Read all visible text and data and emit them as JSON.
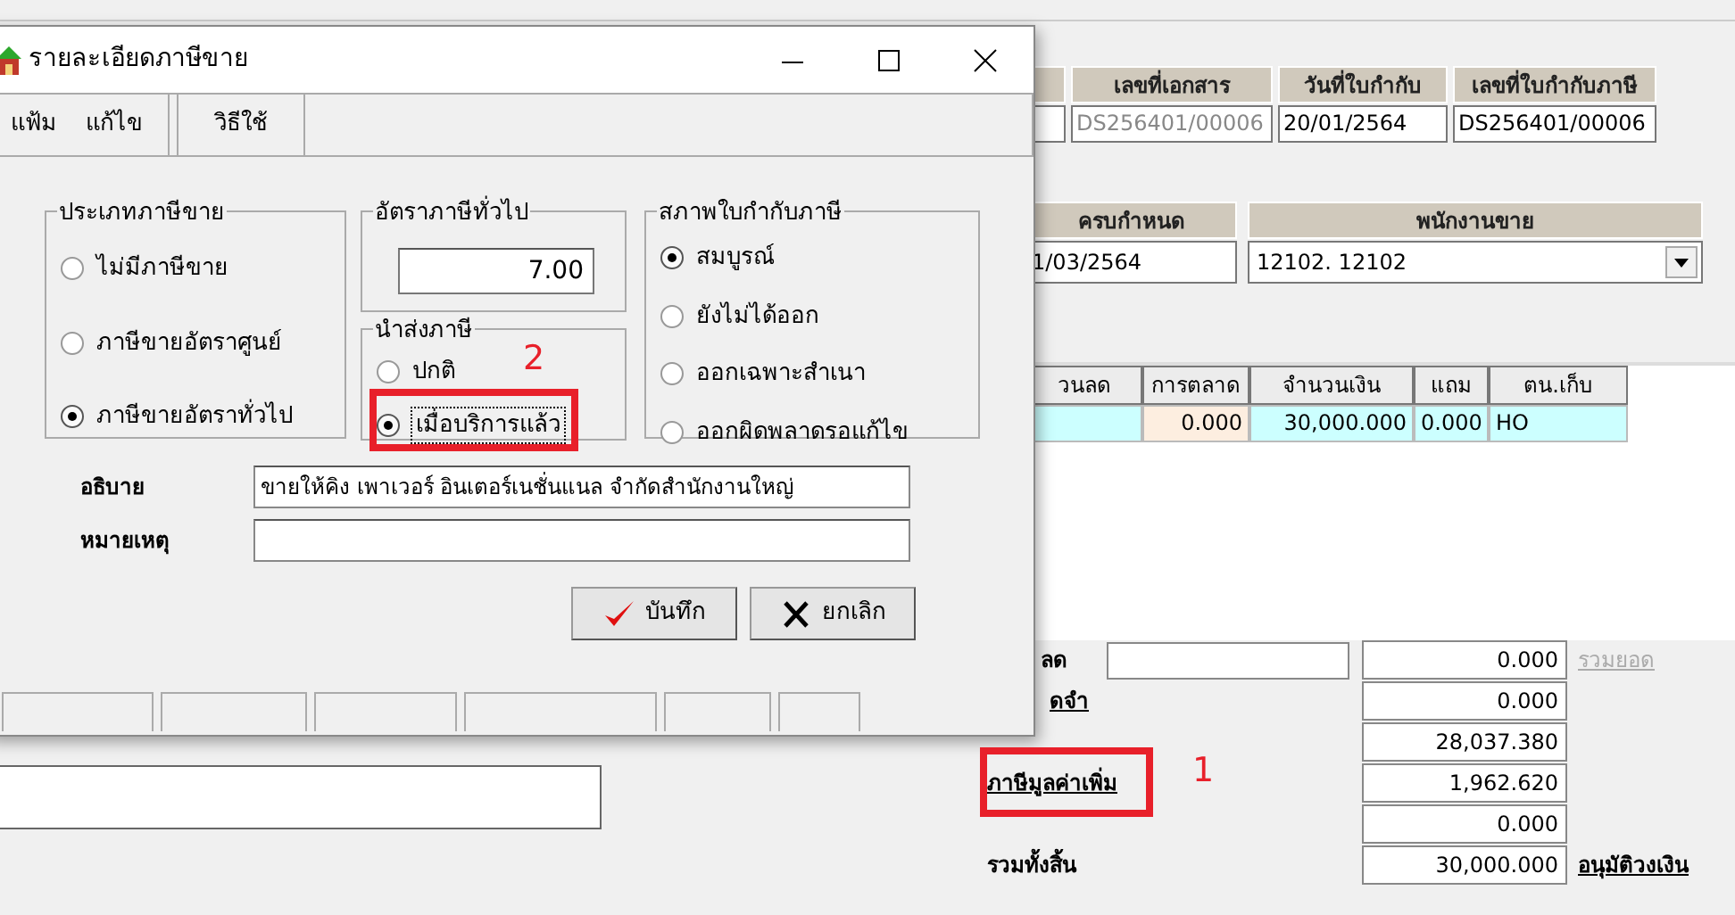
{
  "main_window": {
    "header_fields": [
      {
        "label": "เลขที่เอกสาร",
        "value": "DS256401/00006",
        "disabled": true
      },
      {
        "label": "วันที่ใบกำกับ",
        "value": "20/01/2564",
        "disabled": false
      },
      {
        "label": "เลขที่ใบกำกับภาษี",
        "value": "DS256401/00006",
        "disabled": false
      }
    ],
    "due_date": {
      "label": "ครบกำหนด",
      "value": "1/03/2564"
    },
    "salesperson": {
      "label": "พนักงานขาย",
      "value": "12102. 12102"
    },
    "table": {
      "columns": [
        "วนลด",
        "การตลาด",
        "จำนวนเงิน",
        "แถม",
        "ตน.เก็บ"
      ],
      "rows": [
        {
          "cells": [
            "",
            "0.000",
            "30,000.000",
            "0.000",
            "HO"
          ]
        }
      ]
    },
    "totals": [
      {
        "label": "ลด",
        "link": false,
        "has_input": true,
        "value": "0.000",
        "action": {
          "label": "รวมยอด",
          "disabled": true
        }
      },
      {
        "label": "ดจำ",
        "link": true,
        "has_input": false,
        "value": "0.000"
      },
      {
        "has_input": false,
        "value": "28,037.380"
      },
      {
        "label": "ภาษีมูลค่าเพิ่ม",
        "link": true,
        "has_input": false,
        "value": "1,962.620"
      },
      {
        "has_input": false,
        "value": "0.000"
      },
      {
        "label": "รวมทั้งสิ้น",
        "link": false,
        "has_input": false,
        "value": "30,000.000",
        "action": {
          "label": "อนุมัติวงเงิน",
          "disabled": false
        }
      }
    ]
  },
  "dialog": {
    "title": "รายละเอียดภาษีขาย",
    "menu": [
      "แฟ้ม",
      "แก้ไข",
      "วิธีใช้"
    ],
    "tax_type": {
      "title": "ประเภทภาษีขาย",
      "options": [
        {
          "label": "ไม่มีภาษีขาย",
          "selected": false
        },
        {
          "label": "ภาษีขายอัตราศูนย์",
          "selected": false
        },
        {
          "label": "ภาษีขายอัตราทั่วไป",
          "selected": true
        }
      ]
    },
    "rate": {
      "title": "อัตราภาษีทั่วไป",
      "value": "7.00"
    },
    "remit": {
      "title": "นำส่งภาษี",
      "options": [
        {
          "label": "ปกติ",
          "selected": false
        },
        {
          "label": "เมื่อบริการแล้ว",
          "selected": true
        }
      ]
    },
    "invoice_status": {
      "title": "สภาพใบกำกับภาษี",
      "options": [
        {
          "label": "สมบูรณ์",
          "selected": true
        },
        {
          "label": "ยังไม่ได้ออก",
          "selected": false
        },
        {
          "label": "ออกเฉพาะสำเนา",
          "selected": false
        },
        {
          "label": "ออกผิดพลาดรอแก้ไข",
          "selected": false
        }
      ]
    },
    "description": {
      "label": "อธิบาย",
      "value": "ขายให้คิง เพาเวอร์ อินเตอร์เนชั่นแนล จำกัดสำนักงานใหญ่"
    },
    "note": {
      "label": "หมายเหตุ"
    },
    "buttons": [
      {
        "kind": "save",
        "label": "บันทึก"
      },
      {
        "kind": "cancel",
        "label": "ยกเลิก"
      }
    ]
  },
  "annotations": [
    {
      "label": "1"
    },
    {
      "label": "2"
    }
  ]
}
